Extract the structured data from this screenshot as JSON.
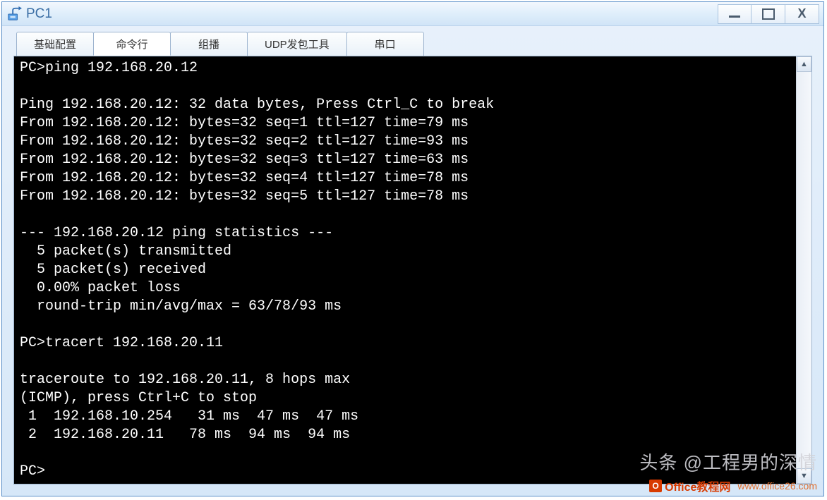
{
  "window": {
    "title": "PC1"
  },
  "tabs": [
    {
      "label": "基础配置"
    },
    {
      "label": "命令行"
    },
    {
      "label": "组播"
    },
    {
      "label": "UDP发包工具"
    },
    {
      "label": "串口"
    }
  ],
  "active_tab_index": 1,
  "terminal_lines": [
    "PC>ping 192.168.20.12",
    "",
    "Ping 192.168.20.12: 32 data bytes, Press Ctrl_C to break",
    "From 192.168.20.12: bytes=32 seq=1 ttl=127 time=79 ms",
    "From 192.168.20.12: bytes=32 seq=2 ttl=127 time=93 ms",
    "From 192.168.20.12: bytes=32 seq=3 ttl=127 time=63 ms",
    "From 192.168.20.12: bytes=32 seq=4 ttl=127 time=78 ms",
    "From 192.168.20.12: bytes=32 seq=5 ttl=127 time=78 ms",
    "",
    "--- 192.168.20.12 ping statistics ---",
    "  5 packet(s) transmitted",
    "  5 packet(s) received",
    "  0.00% packet loss",
    "  round-trip min/avg/max = 63/78/93 ms",
    "",
    "PC>tracert 192.168.20.11",
    "",
    "traceroute to 192.168.20.11, 8 hops max",
    "(ICMP), press Ctrl+C to stop",
    " 1  192.168.10.254   31 ms  47 ms  47 ms",
    " 2  192.168.20.11   78 ms  94 ms  94 ms",
    "",
    "PC>"
  ],
  "watermark": {
    "line1": "头条 @工程男的深情",
    "line2_prefix": "O",
    "line2": "Office教程网",
    "line3": "www.office26.com"
  }
}
